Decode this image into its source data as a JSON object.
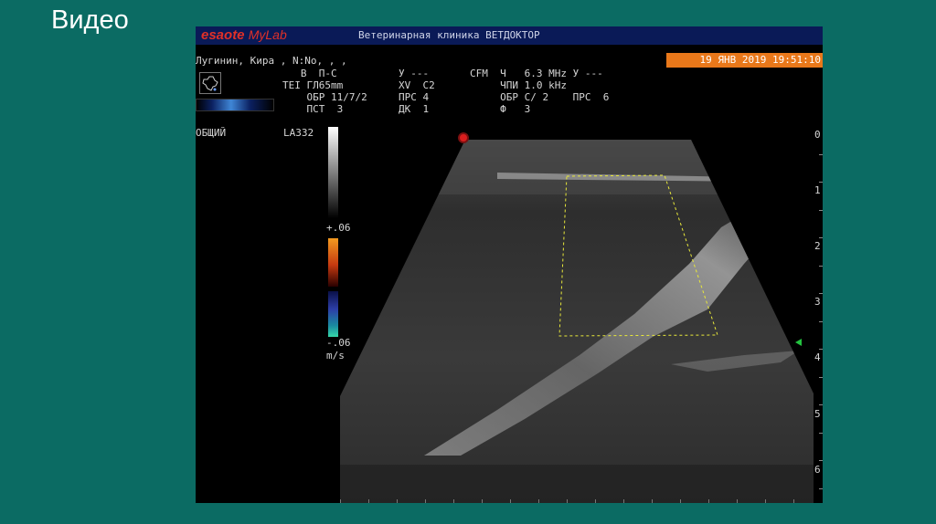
{
  "slide": {
    "title": "Видео"
  },
  "header": {
    "logo_brand": "esaote",
    "logo_product": "MyLab",
    "clinic": "Ветеринарная клиника ВЕТДОКТОР"
  },
  "patient": {
    "line": "Лугинин, Кира , N:No, , ,"
  },
  "datetime": "19 ЯНВ 2019 19:51:10",
  "params": {
    "col1": "   В  П-С\nTEI ГЛ65mm\n    ОБР 11/7/2\n    ПСТ  3",
    "col2": "У ---\nXV  С2\nПРС 4\nДК  1",
    "col3": "CFM  Ч   6.3 MHz У ---\n     ЧПИ 1.0 kHz\n     ОБР С/ 2    ПРС  6\n     Ф   3"
  },
  "labels": {
    "mode": "ОБЩИЙ",
    "probe": "LA332",
    "scale_top": "+.06",
    "scale_bottom": "-.06",
    "scale_unit": "m/s"
  },
  "depth_scale": [
    "0",
    "1",
    "2",
    "3",
    "4",
    "5",
    "6"
  ],
  "colors": {
    "slide_bg": "#0b6b63",
    "header_bar": "#0a1a57",
    "datetime_bg": "#e9781a",
    "roi_box": "#e8e83a",
    "logo": "#e03028"
  }
}
